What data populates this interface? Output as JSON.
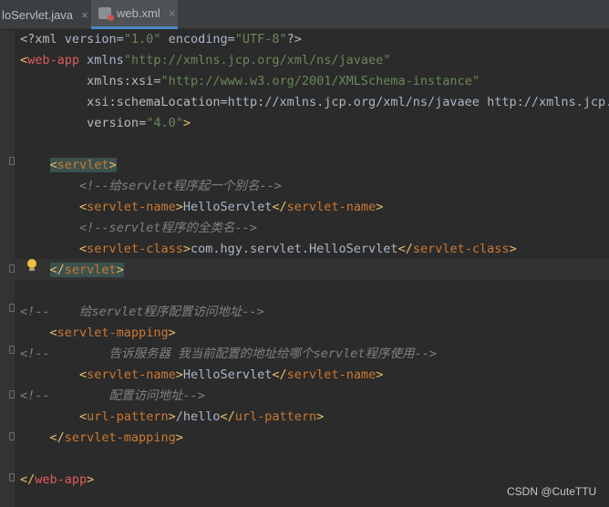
{
  "tabs": [
    {
      "label": "loServlet.java",
      "close": "×"
    },
    {
      "label": "web.xml",
      "close": "×"
    }
  ],
  "lines": [
    "<?xml version=\"1.0\" encoding=\"UTF-8\"?>",
    "<web-app xmlns=\"http://xmlns.jcp.org/xml/ns/javaee\"",
    "         xmlns:xsi=\"http://www.w3.org/2001/XMLSchema-instance\"",
    "         xsi:schemaLocation=\"http://xmlns.jcp.org/xml/ns/javaee http://xmlns.jcp.",
    "         version=\"4.0\">",
    "",
    "    <servlet>",
    "        <!--给servlet程序起一个别名-->",
    "        <servlet-name>HelloServlet</servlet-name>",
    "        <!--servlet程序的全类名-->",
    "        <servlet-class>com.hgy.servlet.HelloServlet</servlet-class>",
    "    </servlet>",
    "",
    "<!--    给servlet程序配置访问地址-->",
    "    <servlet-mapping>",
    "<!--        告诉服务器 我当前配置的地址给哪个servlet程序使用-->",
    "        <servlet-name>HelloServlet</servlet-name>",
    "<!--        配置访问地址-->",
    "        <url-pattern>/hello</url-pattern>",
    "    </servlet-mapping>",
    "",
    "</web-app>"
  ],
  "watermark": "CSDN @CuteTTU",
  "colors": {
    "background": "#2b2b2b",
    "tag": "#e8bf6a",
    "attribute": "#bababa",
    "value": "#6a8759",
    "comment": "#808080"
  }
}
